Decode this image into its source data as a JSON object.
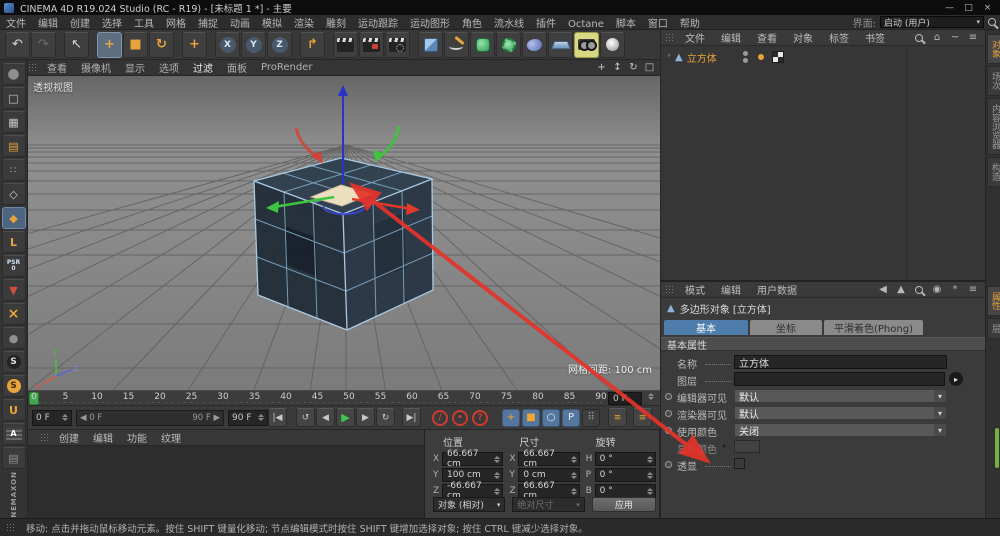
{
  "window": {
    "title": "CINEMA 4D R19.024 Studio (RC - R19) - [未标题 1 *] - 主要",
    "minimize": "—",
    "maximize": "□",
    "close": "×"
  },
  "menu_bar": {
    "items": [
      "文件",
      "编辑",
      "创建",
      "选择",
      "工具",
      "网格",
      "捕捉",
      "动画",
      "模拟",
      "渲染",
      "雕刻",
      "运动跟踪",
      "运动图形",
      "角色",
      "流水线",
      "插件",
      "Octane",
      "脚本",
      "窗口",
      "帮助"
    ],
    "interface_label": "界面:",
    "interface_value": "启动 (用户)"
  },
  "toolbar": {
    "icons": [
      {
        "name": "undo-icon",
        "glyph": "↶",
        "cls": "g-light"
      },
      {
        "name": "redo-icon",
        "glyph": "↷",
        "cls": "g-dim"
      },
      {
        "name": "live-selection-icon",
        "glyph": "↖",
        "cls": "g-light",
        "gap": true
      },
      {
        "name": "move-tool-icon",
        "glyph": "+",
        "cls": "g-orange bold",
        "active": true,
        "gap": true
      },
      {
        "name": "scale-tool-icon",
        "glyph": "■",
        "cls": "g-orange"
      },
      {
        "name": "rotate-tool-icon",
        "glyph": "↻",
        "cls": "g-orange bold"
      },
      {
        "name": "last-tool-icon",
        "glyph": "+",
        "cls": "g-orange bold",
        "gap": true
      },
      {
        "name": "x-axis-lock-icon",
        "kind": "axis",
        "glyph": "X",
        "gap": true
      },
      {
        "name": "y-axis-lock-icon",
        "kind": "axis",
        "glyph": "Y"
      },
      {
        "name": "z-axis-lock-icon",
        "kind": "axis",
        "glyph": "Z"
      },
      {
        "name": "coordinate-system-icon",
        "glyph": "↱",
        "cls": "g-orange bold",
        "gap": true
      },
      {
        "name": "render-view-icon",
        "kind": "clap",
        "gap": true
      },
      {
        "name": "render-picture-viewer-icon",
        "kind": "clap red"
      },
      {
        "name": "render-settings-icon",
        "kind": "clap gear"
      },
      {
        "name": "cube-primitive-icon",
        "kind": "cube",
        "gap": true
      },
      {
        "name": "spline-pen-icon",
        "kind": "pen"
      },
      {
        "name": "subdivision-surface-icon",
        "kind": "subd"
      },
      {
        "name": "modeling-tools-icon",
        "kind": "gear"
      },
      {
        "name": "simulation-icon",
        "kind": "blob"
      },
      {
        "name": "floor-icon",
        "kind": "floor"
      },
      {
        "name": "camera-icon",
        "kind": "cam",
        "cam_active": true
      },
      {
        "name": "light-icon",
        "kind": "light"
      }
    ]
  },
  "left_toolbar": {
    "icons": [
      {
        "name": "make-editable-icon",
        "glyph": "●",
        "cls": "c-gray big"
      },
      {
        "name": "model-mode-icon",
        "glyph": "□",
        "cls": "c-light"
      },
      {
        "name": "texture-mode-icon",
        "glyph": "▦",
        "cls": "c-light"
      },
      {
        "name": "workplane-mode-icon",
        "glyph": "▤",
        "cls": "c-orange"
      },
      {
        "name": "points-mode-icon",
        "glyph": "::",
        "cls": "c-light small"
      },
      {
        "name": "edges-mode-icon",
        "glyph": "◇",
        "cls": "c-light"
      },
      {
        "name": "polygons-mode-icon",
        "glyph": "◆",
        "cls": "c-orange",
        "active": true
      },
      {
        "name": "enable-axis-icon",
        "glyph": "L",
        "cls": "c-orange bold"
      },
      {
        "name": "psr-quantize-icon",
        "lines": [
          "PSR",
          "0"
        ]
      },
      {
        "name": "viewport-solo-icon",
        "glyph": "▼",
        "cls": "c-red"
      },
      {
        "name": "snap-icon",
        "glyph": "×",
        "cls": "c-orange bold big"
      },
      {
        "name": "mouse-interaction-icon",
        "glyph": "●",
        "cls": "c-gray"
      },
      {
        "name": "auto-switch-mode-icon",
        "glyph": "S",
        "cls": "pill-dark"
      },
      {
        "name": "snap-toggle-icon",
        "glyph": "S",
        "cls": "pill-orange"
      },
      {
        "name": "magnet-icon",
        "glyph": "U",
        "cls": "c-orange bold"
      },
      {
        "name": "workplane-lock-icon",
        "glyph": "A",
        "cls": "striped"
      },
      {
        "name": "planar-workplane-icon",
        "glyph": "▤",
        "cls": "c-gray"
      }
    ],
    "brand_top": "MAXON",
    "brand_bottom": "CINE"
  },
  "viewport": {
    "menu": [
      "查看",
      "摄像机",
      "显示",
      "选项",
      "过滤",
      "面板",
      "ProRender"
    ],
    "controls": [
      {
        "name": "pan-view-icon",
        "glyph": "+"
      },
      {
        "name": "zoom-view-icon",
        "glyph": "↕"
      },
      {
        "name": "rotate-view-icon",
        "glyph": "↻"
      },
      {
        "name": "toggle-view-icon",
        "glyph": "□"
      }
    ],
    "view_label": "透视视图",
    "grid_spacing_label": "网格间距: 100 cm",
    "axis_y": "Y",
    "axis_x": "x",
    "axis_z": "z"
  },
  "object_manager": {
    "menu": [
      "文件",
      "编辑",
      "查看",
      "对象",
      "标签",
      "书签"
    ],
    "icons": [
      {
        "name": "search-icon",
        "type": "search"
      },
      {
        "name": "home-icon",
        "glyph": "⌂"
      },
      {
        "name": "path-icon",
        "glyph": "~"
      },
      {
        "name": "panel-menu-icon",
        "glyph": "≡"
      }
    ],
    "object": {
      "name": "立方体"
    },
    "vertical_tabs": [
      {
        "label": "对象",
        "active": true
      },
      {
        "label": "场次"
      },
      {
        "label": "内容浏览器"
      },
      {
        "label": "构造"
      }
    ]
  },
  "attribute_manager": {
    "menu": [
      "模式",
      "编辑",
      "用户数据"
    ],
    "icons": [
      {
        "name": "history-back-icon",
        "glyph": "◀"
      },
      {
        "name": "history-up-icon",
        "glyph": "▲"
      },
      {
        "name": "search-icon",
        "type": "search"
      },
      {
        "name": "lock-icon",
        "glyph": "◉"
      },
      {
        "name": "settings-icon",
        "glyph": "*"
      },
      {
        "name": "panel-menu-icon",
        "glyph": "≡"
      }
    ],
    "object_title": "多边形对象 [立方体]",
    "tabs": [
      {
        "label": "基本",
        "active": true
      },
      {
        "label": "坐标"
      },
      {
        "label": "平滑着色(Phong)"
      }
    ],
    "section": "基本属性",
    "rows": [
      {
        "label": "名称",
        "type": "text",
        "value": "立方体",
        "leader": true
      },
      {
        "label": "图层",
        "type": "layer",
        "value": "",
        "leader": true
      },
      {
        "label": "编辑器可见",
        "type": "dropdown",
        "value": "默认",
        "anim": true
      },
      {
        "label": "渲染器可见",
        "type": "dropdown",
        "value": "默认",
        "anim": true
      },
      {
        "label": "使用颜色",
        "type": "dropdown",
        "value": "关闭",
        "anim": true
      },
      {
        "label": "显示颜色",
        "type": "color",
        "value": "",
        "expander": true,
        "dim": true
      },
      {
        "label": "透显",
        "type": "checkbox",
        "checked": false,
        "anim": true,
        "leader": true
      }
    ],
    "vertical_tabs": [
      {
        "label": "属性",
        "active": true
      },
      {
        "label": "层"
      }
    ]
  },
  "timeline": {
    "ticks": [
      0,
      5,
      10,
      15,
      20,
      25,
      30,
      35,
      40,
      45,
      50,
      55,
      60,
      65,
      70,
      75,
      80,
      85,
      90
    ],
    "current_frame": "0 F",
    "start_field": "0 F",
    "end_field": "90 F",
    "range_start": "0 F",
    "range_end": "90 F",
    "transport": [
      {
        "name": "go-to-start-button",
        "glyph": "|◀",
        "cls": "tp"
      },
      {
        "name": "go-to-previous-key-button",
        "glyph": "↺",
        "cls": "tp ml8"
      },
      {
        "name": "previous-frame-button",
        "glyph": "◀",
        "cls": "tp"
      },
      {
        "name": "play-button",
        "glyph": "▶",
        "cls": "tp play"
      },
      {
        "name": "next-frame-button",
        "glyph": "▶",
        "cls": "tp"
      },
      {
        "name": "go-to-next-key-button",
        "glyph": "↻",
        "cls": "tp"
      },
      {
        "name": "go-to-end-button",
        "glyph": "▶|",
        "cls": "tp ml6"
      },
      {
        "name": "record-keyframe-button",
        "glyph": "/",
        "cls": "rec ml10"
      },
      {
        "name": "autokey-button",
        "glyph": "•",
        "cls": "rec"
      },
      {
        "name": "record-options-button",
        "glyph": "?",
        "cls": "rec"
      },
      {
        "name": "record-position-toggle",
        "glyph": "+",
        "gcls": "og",
        "cls": "tog on ml12"
      },
      {
        "name": "record-scale-toggle",
        "glyph": "■",
        "gcls": "og",
        "cls": "tog on"
      },
      {
        "name": "record-rotation-toggle",
        "glyph": "○",
        "gcls": "wt",
        "cls": "tog on"
      },
      {
        "name": "record-parameter-toggle",
        "glyph": "P",
        "gcls": "wt",
        "cls": "tog on"
      },
      {
        "name": "record-pla-toggle",
        "glyph": "⠿",
        "cls": "tog off"
      },
      {
        "name": "keyframe-selection-button",
        "glyph": "≡",
        "gcls": "og",
        "cls": "tp ml6"
      },
      {
        "name": "open-timeline-button",
        "glyph": "≡",
        "gcls": "og",
        "cls": "tp mla"
      }
    ]
  },
  "material_manager": {
    "menu": [
      "创建",
      "编辑",
      "功能",
      "纹理"
    ]
  },
  "coordinates": {
    "groups": [
      {
        "title": "位置",
        "fields": [
          {
            "axis": "X",
            "value": "66.667 cm"
          },
          {
            "axis": "Y",
            "value": "100 cm"
          },
          {
            "axis": "Z",
            "value": "-66.667 cm"
          }
        ]
      },
      {
        "title": "尺寸",
        "fields": [
          {
            "axis": "X",
            "value": "66.667 cm"
          },
          {
            "axis": "Y",
            "value": "0 cm"
          },
          {
            "axis": "Z",
            "value": "66.667 cm"
          }
        ]
      },
      {
        "title": "旋转",
        "fields": [
          {
            "axis": "H",
            "value": "0 °"
          },
          {
            "axis": "P",
            "value": "0 °"
          },
          {
            "axis": "B",
            "value": "0 °"
          }
        ]
      }
    ],
    "mode_dropdown": "对象 (相对)",
    "size_dropdown": "绝对尺寸",
    "apply_label": "应用"
  },
  "status_bar": {
    "text": "移动: 点击并拖动鼠标移动元素。按住 SHIFT 键量化移动; 节点编辑模式时按住 SHIFT 键增加选择对象; 按住 CTRL 键减少选择对象。"
  },
  "colors": {
    "accent_orange": "#e8a33d",
    "tab_blue": "#4e7cab",
    "annotation_red": "#e4342b",
    "selected_face": "#ecdfc0",
    "timeline_green": "#42aa4e"
  }
}
